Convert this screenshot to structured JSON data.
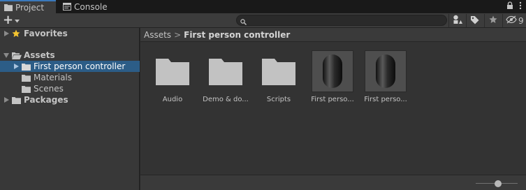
{
  "tabs": [
    {
      "label": "Project",
      "icon": "folder-icon",
      "active": true
    },
    {
      "label": "Console",
      "icon": "console-icon",
      "active": false
    }
  ],
  "toolbar": {
    "create_label": "+",
    "search_placeholder": "",
    "hidden_count": "9"
  },
  "tree": {
    "items": [
      {
        "label": "Favorites",
        "icon": "star-icon",
        "expanded": false,
        "level": 0,
        "bold": true
      },
      {
        "label": "Assets",
        "icon": "open-folder-icon",
        "expanded": true,
        "level": 0,
        "bold": true
      },
      {
        "label": "First person controller",
        "icon": "folder-icon",
        "expanded": false,
        "level": 1,
        "selected": true
      },
      {
        "label": "Materials",
        "icon": "folder-icon",
        "level": 1
      },
      {
        "label": "Scenes",
        "icon": "folder-icon",
        "level": 1
      },
      {
        "label": "Packages",
        "icon": "folder-icon",
        "expanded": false,
        "level": 0,
        "bold": true
      }
    ]
  },
  "breadcrumb": {
    "root": "Assets",
    "separator": ">",
    "current": "First person controller"
  },
  "assets": [
    {
      "label": "Audio",
      "type": "folder"
    },
    {
      "label": "Demo & do...",
      "type": "folder"
    },
    {
      "label": "Scripts",
      "type": "folder"
    },
    {
      "label": "First perso...",
      "type": "model"
    },
    {
      "label": "First perso...",
      "type": "model"
    }
  ],
  "colors": {
    "selection": "#2c5d87",
    "tab_accent": "#3a79bb",
    "star": "#f4c430",
    "folder": "#c2c2c2"
  }
}
